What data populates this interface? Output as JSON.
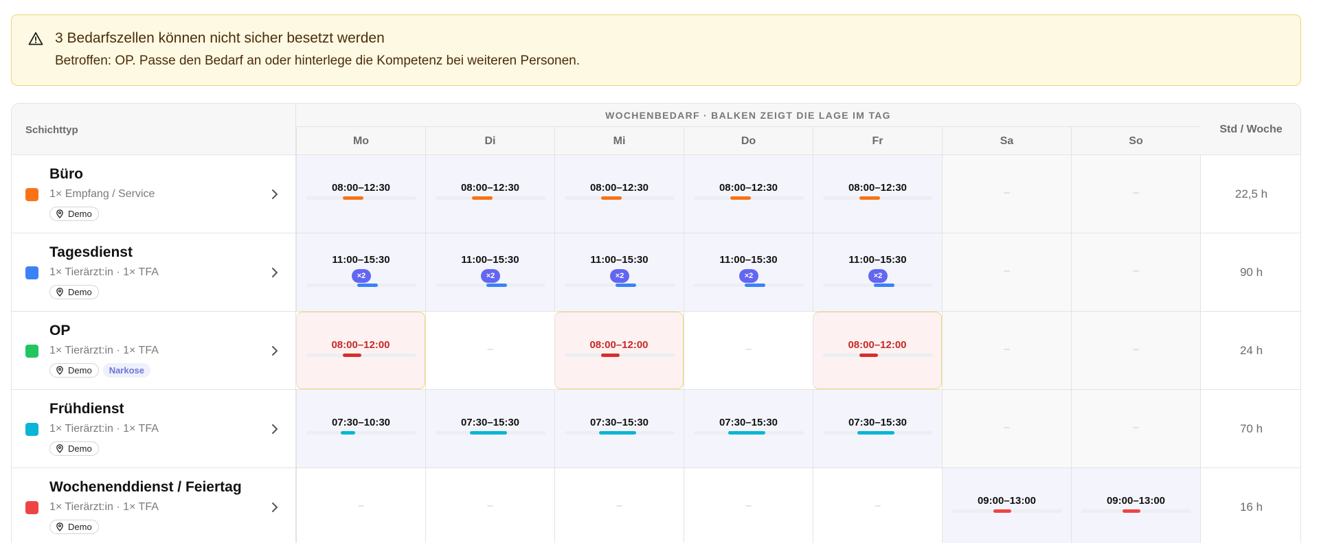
{
  "alert": {
    "icon": "warning-triangle-icon",
    "title": "3 Bedarfszellen können nicht sicher besetzt werden",
    "text": "Betroffen: OP. Passe den Bedarf an oder hinterlege die Kompetenz bei weiteren Personen.",
    "colors": {
      "background": "#fdf9e3",
      "border": "#ecd776",
      "text": "#4a2d0a"
    }
  },
  "table": {
    "col_shift_type": "Schichttyp",
    "group_header": "WOCHENBEDARF · BALKEN ZEIGT DIE LAGE IM TAG",
    "days": [
      "Mo",
      "Di",
      "Mi",
      "Do",
      "Fr",
      "Sa",
      "So"
    ],
    "col_hours": "Std / Woche",
    "empty_symbol": "–",
    "colors": {
      "active_cell": "#f4f5fc",
      "conflict_cell": "#fdf1f1",
      "conflict_text": "#c62828",
      "weekend_cell": "#f9f9f9",
      "multiplier_badge": "#6366f1"
    },
    "rows": [
      {
        "name": "Büro",
        "color": "#f97316",
        "sub": "1× Empfang / Service",
        "location": "Demo",
        "skill": "",
        "hours": "22,5 h",
        "cells": [
          {
            "time": "08:00–12:30",
            "start_frac": 0.33,
            "end_frac": 0.52
          },
          {
            "time": "08:00–12:30",
            "start_frac": 0.33,
            "end_frac": 0.52
          },
          {
            "time": "08:00–12:30",
            "start_frac": 0.33,
            "end_frac": 0.52
          },
          {
            "time": "08:00–12:30",
            "start_frac": 0.33,
            "end_frac": 0.52
          },
          {
            "time": "08:00–12:30",
            "start_frac": 0.33,
            "end_frac": 0.52
          },
          null,
          null
        ]
      },
      {
        "name": "Tagesdienst",
        "color": "#3b82f6",
        "sub": "1× Tierärzt:in · 1× TFA",
        "location": "Demo",
        "skill": "",
        "hours": "90 h",
        "cells": [
          {
            "time": "11:00–15:30",
            "multiplier": "×2",
            "start_frac": 0.46,
            "end_frac": 0.65
          },
          {
            "time": "11:00–15:30",
            "multiplier": "×2",
            "start_frac": 0.46,
            "end_frac": 0.65
          },
          {
            "time": "11:00–15:30",
            "multiplier": "×2",
            "start_frac": 0.46,
            "end_frac": 0.65
          },
          {
            "time": "11:00–15:30",
            "multiplier": "×2",
            "start_frac": 0.46,
            "end_frac": 0.65
          },
          {
            "time": "11:00–15:30",
            "multiplier": "×2",
            "start_frac": 0.46,
            "end_frac": 0.65
          },
          null,
          null
        ]
      },
      {
        "name": "OP",
        "color": "#22c55e",
        "sub": "1× Tierärzt:in · 1× TFA",
        "location": "Demo",
        "skill": "Narkose",
        "hours": "24 h",
        "cells": [
          {
            "time": "08:00–12:00",
            "conflict": true,
            "start_frac": 0.33,
            "end_frac": 0.5
          },
          null,
          {
            "time": "08:00–12:00",
            "conflict": true,
            "start_frac": 0.33,
            "end_frac": 0.5
          },
          null,
          {
            "time": "08:00–12:00",
            "conflict": true,
            "start_frac": 0.33,
            "end_frac": 0.5
          },
          null,
          null
        ]
      },
      {
        "name": "Frühdienst",
        "color": "#06b6d4",
        "sub": "1× Tierärzt:in · 1× TFA",
        "location": "Demo",
        "skill": "",
        "hours": "70 h",
        "cells": [
          {
            "time": "07:30–10:30",
            "start_frac": 0.31,
            "end_frac": 0.44
          },
          {
            "time": "07:30–15:30",
            "start_frac": 0.31,
            "end_frac": 0.65
          },
          {
            "time": "07:30–15:30",
            "start_frac": 0.31,
            "end_frac": 0.65
          },
          {
            "time": "07:30–15:30",
            "start_frac": 0.31,
            "end_frac": 0.65
          },
          {
            "time": "07:30–15:30",
            "start_frac": 0.31,
            "end_frac": 0.65
          },
          null,
          null
        ]
      },
      {
        "name": "Wochenenddienst / Feiertag",
        "color": "#ef4444",
        "sub": "1× Tierärzt:in · 1× TFA",
        "location": "Demo",
        "skill": "",
        "hours": "16 h",
        "cells": [
          null,
          null,
          null,
          null,
          null,
          {
            "time": "09:00–13:00",
            "start_frac": 0.375,
            "end_frac": 0.54
          },
          {
            "time": "09:00–13:00",
            "start_frac": 0.375,
            "end_frac": 0.54
          }
        ]
      }
    ]
  }
}
